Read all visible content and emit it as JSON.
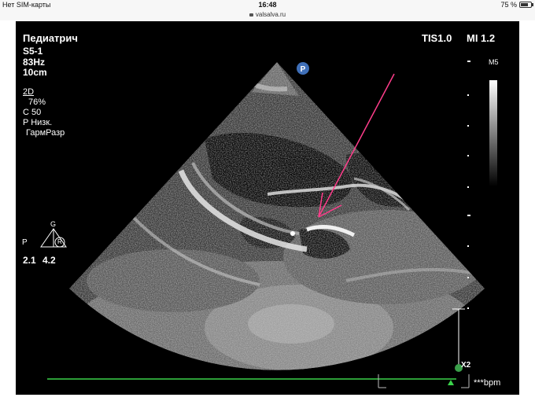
{
  "status_bar": {
    "carrier": "Нет SIM-карты",
    "time": "16:48",
    "battery": "75 %",
    "battery_level": 0.75
  },
  "address_bar": {
    "url": "valsalva.ru"
  },
  "ultrasound": {
    "preset": "Педиатрич",
    "probe": "S5-1",
    "frame_rate": "83Hz",
    "depth": "10cm",
    "mode": "2D",
    "gain": "76%",
    "compression": "C 50",
    "power": "P Низк.",
    "harmonic": "ГармРазр",
    "tis": "TIS1.0",
    "mi": "MI 1.2",
    "map": "M5",
    "orientation_marker": "P",
    "focus_letter_p": "P",
    "focus_letter_g": "G",
    "focus_letter_r": "R",
    "focus_value_left": "2.1",
    "focus_value_right": "4.2",
    "zoom": "X2",
    "heart_rate": "***bpm"
  }
}
